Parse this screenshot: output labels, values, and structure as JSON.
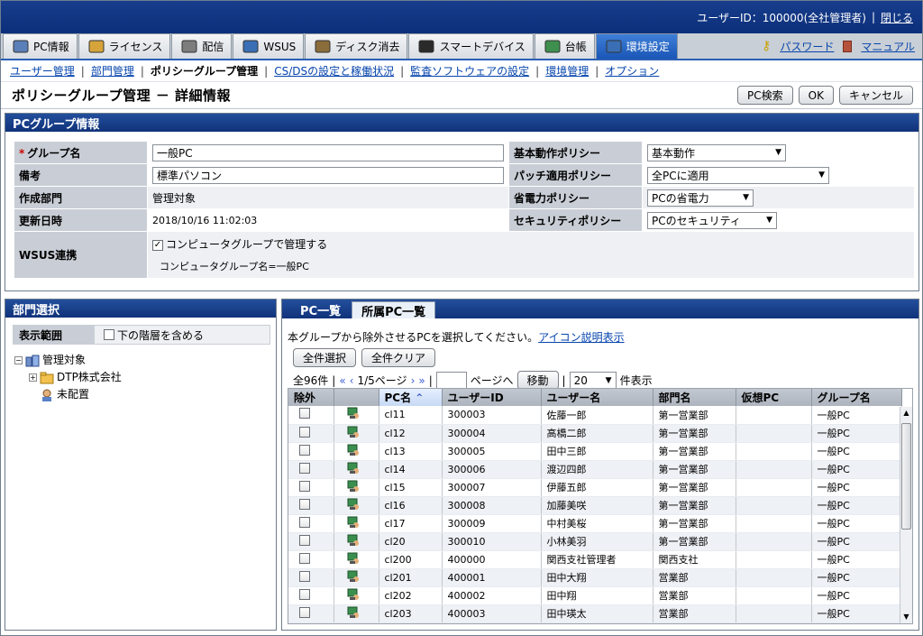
{
  "header": {
    "user_label": "ユーザーID：100000(全社管理者)",
    "close_link": "閉じる"
  },
  "tabs": [
    {
      "label": "PC情報",
      "icon": "pc-info-icon"
    },
    {
      "label": "ライセンス",
      "icon": "license-icon"
    },
    {
      "label": "配信",
      "icon": "distribution-icon"
    },
    {
      "label": "WSUS",
      "icon": "wsus-icon"
    },
    {
      "label": "ディスク消去",
      "icon": "disk-erase-icon"
    },
    {
      "label": "スマートデバイス",
      "icon": "smart-device-icon"
    },
    {
      "label": "台帳",
      "icon": "ledger-icon"
    },
    {
      "label": "環境設定",
      "icon": "settings-icon"
    }
  ],
  "right_links": {
    "password": "パスワード",
    "manual": "マニュアル"
  },
  "subnav": {
    "items": [
      "ユーザー管理",
      "部門管理",
      "ポリシーグループ管理",
      "CS/DSの設定と稼働状況",
      "監査ソフトウェアの設定",
      "環境管理",
      "オプション"
    ]
  },
  "page": {
    "title": "ポリシーグループ管理 － 詳細情報",
    "buttons": {
      "pc_search": "PC検索",
      "ok": "OK",
      "cancel": "キャンセル"
    }
  },
  "group_info": {
    "section_title": "PCグループ情報",
    "group_name_label": "グループ名",
    "group_name_value": "一般PC",
    "note_label": "備考",
    "note_value": "標準パソコン",
    "created_dept_label": "作成部門",
    "created_dept_value": "管理対象",
    "updated_label": "更新日時",
    "updated_value": "2018/10/16 11:02:03",
    "wsus_label": "WSUS連携",
    "wsus_check_label": "コンピュータグループで管理する",
    "wsus_group_text": "コンピュータグループ名=一般PC",
    "basic_policy_label": "基本動作ポリシー",
    "basic_policy_value": "基本動作",
    "patch_policy_label": "パッチ適用ポリシー",
    "patch_policy_value": "全PCに適用",
    "power_policy_label": "省電力ポリシー",
    "power_policy_value": "PCの省電力",
    "security_policy_label": "セキュリティポリシー",
    "security_policy_value": "PCのセキュリティ"
  },
  "dept": {
    "section_title": "部門選択",
    "range_label": "表示範囲",
    "include_lower_label": "下の階層を含める",
    "tree": {
      "root": "管理対象",
      "child1": "DTP株式会社",
      "child2": "未配置"
    }
  },
  "pclist": {
    "tab1": "PC一覧",
    "tab2": "所属PC一覧",
    "message": "本グループから除外させるPCを選択してください。",
    "icon_help_link": "アイコン説明表示",
    "select_all": "全件選択",
    "clear_all": "全件クリア",
    "total": "全96件",
    "page_info": "1/5ページ",
    "page_suffix": "ページへ",
    "move": "移動",
    "per_page_value": "20",
    "per_page_suffix": "件表示",
    "columns": [
      "除外",
      "",
      "PC名",
      "ユーザーID",
      "ユーザー名",
      "部門名",
      "仮想PC",
      "グループ名"
    ],
    "rows": [
      {
        "pc": "cl11",
        "uid": "300003",
        "uname": "佐藤一郎",
        "dept": "第一営業部",
        "vpc": "",
        "group": "一般PC"
      },
      {
        "pc": "cl12",
        "uid": "300004",
        "uname": "高橋二郎",
        "dept": "第一営業部",
        "vpc": "",
        "group": "一般PC"
      },
      {
        "pc": "cl13",
        "uid": "300005",
        "uname": "田中三郎",
        "dept": "第一営業部",
        "vpc": "",
        "group": "一般PC"
      },
      {
        "pc": "cl14",
        "uid": "300006",
        "uname": "渡辺四郎",
        "dept": "第一営業部",
        "vpc": "",
        "group": "一般PC"
      },
      {
        "pc": "cl15",
        "uid": "300007",
        "uname": "伊藤五郎",
        "dept": "第一営業部",
        "vpc": "",
        "group": "一般PC"
      },
      {
        "pc": "cl16",
        "uid": "300008",
        "uname": "加藤美咲",
        "dept": "第一営業部",
        "vpc": "",
        "group": "一般PC"
      },
      {
        "pc": "cl17",
        "uid": "300009",
        "uname": "中村美桜",
        "dept": "第一営業部",
        "vpc": "",
        "group": "一般PC"
      },
      {
        "pc": "cl20",
        "uid": "300010",
        "uname": "小林美羽",
        "dept": "第一営業部",
        "vpc": "",
        "group": "一般PC"
      },
      {
        "pc": "cl200",
        "uid": "400000",
        "uname": "関西支社管理者",
        "dept": "関西支社",
        "vpc": "",
        "group": "一般PC"
      },
      {
        "pc": "cl201",
        "uid": "400001",
        "uname": "田中大翔",
        "dept": "営業部",
        "vpc": "",
        "group": "一般PC"
      },
      {
        "pc": "cl202",
        "uid": "400002",
        "uname": "田中翔",
        "dept": "営業部",
        "vpc": "",
        "group": "一般PC"
      },
      {
        "pc": "cl203",
        "uid": "400003",
        "uname": "田中瑛太",
        "dept": "営業部",
        "vpc": "",
        "group": "一般PC"
      }
    ]
  }
}
